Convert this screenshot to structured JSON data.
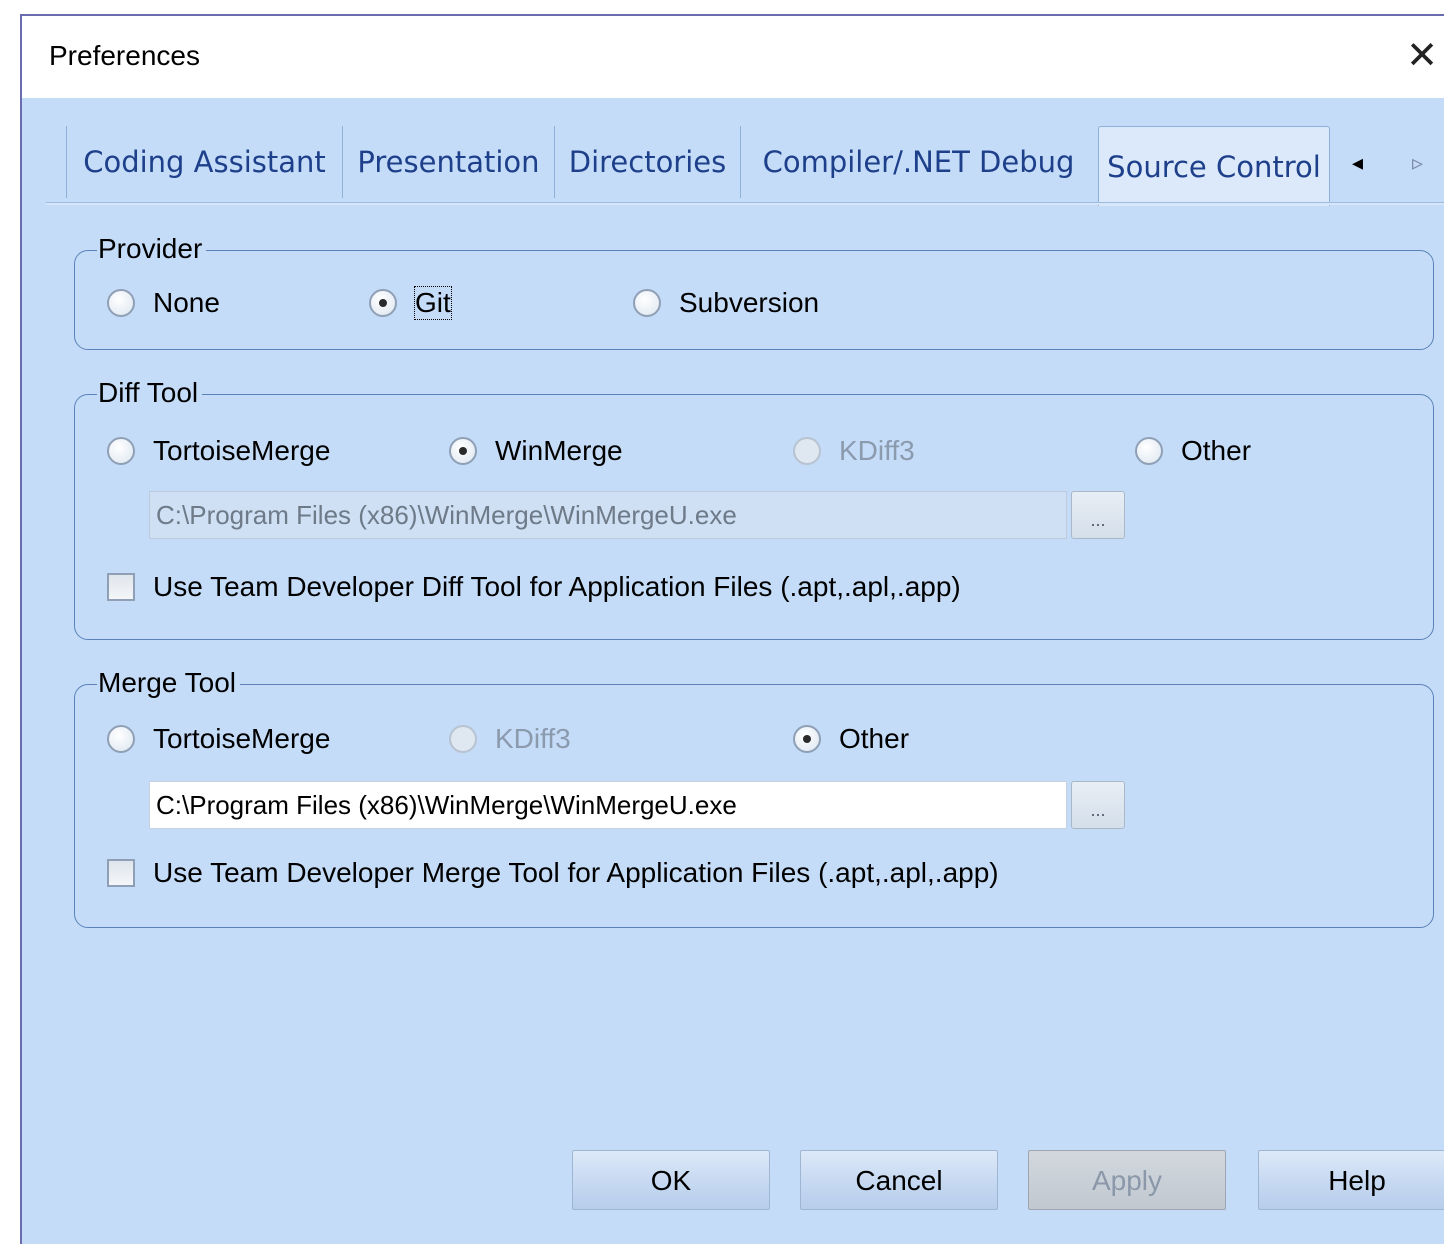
{
  "window": {
    "title": "Preferences",
    "close_glyph": "✕"
  },
  "tabs": [
    {
      "label": "Coding Assistant"
    },
    {
      "label": "Presentation"
    },
    {
      "label": "Directories"
    },
    {
      "label": "Compiler/.NET Debug"
    },
    {
      "label": "Source Control",
      "active": true
    }
  ],
  "tab_arrows": {
    "left": "◂",
    "right": "▹"
  },
  "provider": {
    "legend": "Provider",
    "options": [
      "None",
      "Git",
      "Subversion"
    ],
    "selected": "Git"
  },
  "diff_tool": {
    "legend": "Diff Tool",
    "options": [
      "TortoiseMerge",
      "WinMerge",
      "KDiff3",
      "Other"
    ],
    "disabled": [
      "KDiff3"
    ],
    "selected": "WinMerge",
    "path": "C:\\Program Files (x86)\\WinMerge\\WinMergeU.exe",
    "path_enabled": false,
    "browse_label": "...",
    "checkbox_label": "Use Team Developer Diff Tool for Application Files (.apt,.apl,.app)",
    "checkbox_checked": false
  },
  "merge_tool": {
    "legend": "Merge Tool",
    "options": [
      "TortoiseMerge",
      "KDiff3",
      "Other"
    ],
    "disabled": [
      "KDiff3"
    ],
    "selected": "Other",
    "path": "C:\\Program Files (x86)\\WinMerge\\WinMergeU.exe",
    "path_enabled": true,
    "browse_label": "...",
    "checkbox_label": "Use Team Developer Merge Tool for Application Files (.apt,.apl,.app)",
    "checkbox_checked": false
  },
  "buttons": {
    "ok": "OK",
    "cancel": "Cancel",
    "apply": "Apply",
    "help": "Help"
  }
}
